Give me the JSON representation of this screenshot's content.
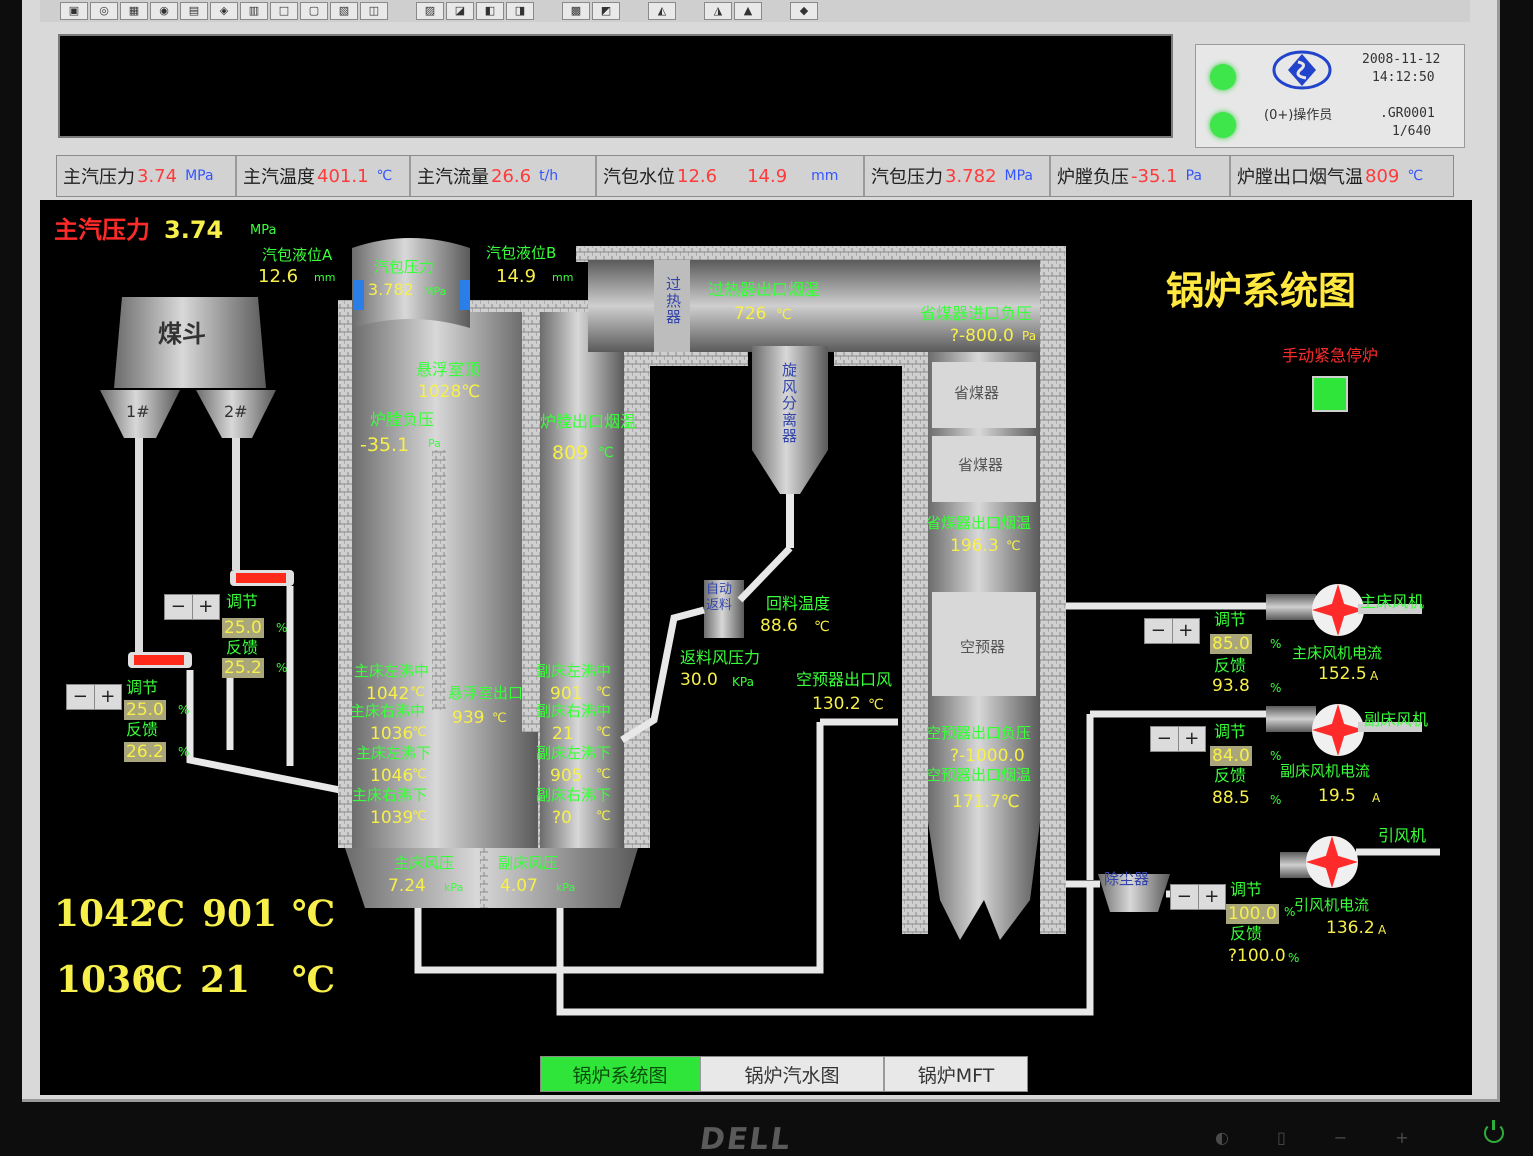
{
  "toolbar": {
    "buttons": [
      "▣",
      "◎",
      "▦",
      "◉",
      "▤",
      "◈",
      "▥",
      "□",
      "▢",
      "▧",
      "◫",
      "▨",
      "◪",
      "◧",
      "◨",
      "▩",
      "◩",
      "◭",
      "◮",
      "▲",
      "◆"
    ]
  },
  "status": {
    "datetime_line1": "2008-11-12",
    "datetime_line2": "14:12:50",
    "operator": "(0+)操作员",
    "code_line1": ".GR0001",
    "code_line2": "1/640"
  },
  "params": [
    {
      "label": "主汽压力",
      "value": "3.74",
      "unit": "MPa"
    },
    {
      "label": "主汽温度",
      "value": "401.1",
      "unit": "℃"
    },
    {
      "label": "主汽流量",
      "value": "26.6",
      "unit": "t/h"
    },
    {
      "label": "汽包水位",
      "value": "12.6",
      "value2": "14.9",
      "unit": "mm"
    },
    {
      "label": "汽包压力",
      "value": "3.782",
      "unit": "MPa"
    },
    {
      "label": "炉膛负压",
      "value": "-35.1",
      "unit": "Pa"
    },
    {
      "label": "炉膛出口烟气温",
      "value": "809",
      "unit": "℃"
    }
  ],
  "diagram": {
    "title": "锅炉系统图",
    "main_pressure_label": "主汽压力",
    "main_pressure_value": "3.74",
    "main_pressure_unit": "MPa",
    "drum_level_a_label": "汽包液位A",
    "drum_level_a_value": "12.6",
    "drum_level_a_unit": "mm",
    "drum_pressure_label": "汽包压力",
    "drum_pressure_value": "3.782",
    "drum_pressure_unit": "MPa",
    "drum_level_b_label": "汽包液位B",
    "drum_level_b_value": "14.9",
    "drum_level_b_unit": "mm",
    "coal_hopper": "煤斗",
    "hopper_1": "1#",
    "hopper_2": "2#",
    "superheater": "过热器",
    "superheater_outlet_label": "过热器出口烟温",
    "superheater_outlet_value": "726",
    "superheater_outlet_unit": "℃",
    "economizer_inlet_label": "省煤器进口负压",
    "economizer_inlet_value": "?-800.0",
    "economizer_inlet_unit": "Pa",
    "suspended_top_label": "悬浮室顶",
    "suspended_top_value": "1028℃",
    "furnace_neg_label": "炉膛负压",
    "furnace_neg_value": "-35.1",
    "furnace_neg_unit": "Pa",
    "furnace_outlet_label": "炉膛出口烟温",
    "furnace_outlet_value": "809",
    "furnace_outlet_unit": "℃",
    "cyclone": "旋风分离器",
    "economizer_1": "省煤器",
    "economizer_2": "省煤器",
    "economizer_outlet_label": "省煤器出口烟温",
    "economizer_outlet_value": "196.3",
    "economizer_outlet_unit": "℃",
    "return_feeder": "自动返料",
    "return_temp_label": "回料温度",
    "return_temp_value": "88.6",
    "return_temp_unit": "℃",
    "return_air_label": "返料风压力",
    "return_air_value": "30.0",
    "return_air_unit": "KPa",
    "air_preheater": "空预器",
    "preheater_air_label": "空预器出口风",
    "preheater_air_value": "130.2",
    "preheater_air_unit": "℃",
    "preheater_neg_label": "空预器出口负压",
    "preheater_neg_value": "?-1000.0",
    "preheater_smoke_label": "空预器出口烟温",
    "preheater_smoke_value": "171.7℃",
    "main_bed_lm_label": "主床左沸中",
    "main_bed_lm_value": "1042",
    "main_bed_rm_label": "主床右沸中",
    "main_bed_rm_value": "1036",
    "main_bed_ll_label": "主床左沸下",
    "main_bed_ll_value": "1046",
    "main_bed_rl_label": "主床右沸下",
    "main_bed_rl_value": "1039",
    "temp_unit": "℃",
    "suspended_out_label": "悬浮室出口",
    "suspended_out_value": "939",
    "aux_bed_lm_label": "副床左沸中",
    "aux_bed_lm_value": "901",
    "aux_bed_rm_label": "副床右沸中",
    "aux_bed_rm_value": "21",
    "aux_bed_ll_label": "副床左沸下",
    "aux_bed_ll_value": "905",
    "aux_bed_rl_label": "副床右沸下",
    "aux_bed_rl_value": "?0",
    "main_bed_air_label": "主床风压",
    "main_bed_air_value": "7.24",
    "main_bed_air_unit": "kPa",
    "aux_bed_air_label": "副床风压",
    "aux_bed_air_value": "4.07",
    "aux_bed_air_unit": "kPa",
    "dust_collector": "除尘器",
    "emergency_stop": "手动紧急停炉",
    "feeder2": {
      "adjust": "调节",
      "adjust_value": "25.0",
      "feedback": "反馈",
      "feedback_value": "25.2",
      "unit": "%"
    },
    "feeder1": {
      "adjust": "调节",
      "adjust_value": "25.0",
      "feedback": "反馈",
      "feedback_value": "26.2",
      "unit": "%"
    },
    "main_fan": {
      "name": "主床风机",
      "adjust": "调节",
      "adjust_value": "85.0",
      "feedback": "反馈",
      "feedback_value": "93.8",
      "unit": "%",
      "current_label": "主床风机电流",
      "current_value": "152.5",
      "current_unit": "A"
    },
    "aux_fan": {
      "name": "副床风机",
      "adjust": "调节",
      "adjust_value": "84.0",
      "feedback": "反馈",
      "feedback_value": "88.5",
      "unit": "%",
      "current_label": "副床风机电流",
      "current_value": "19.5",
      "current_unit": "A"
    },
    "id_fan": {
      "name": "引风机",
      "adjust": "调节",
      "adjust_value": "100.0",
      "feedback": "反馈",
      "feedback_value": "?100.0",
      "unit": "%",
      "current_label": "引风机电流",
      "current_value": "136.2",
      "current_unit": "A"
    },
    "big_t1": "1042",
    "big_t2": "901",
    "big_t3": "1036",
    "big_t4": "21",
    "big_unit": "℃",
    "minus": "−",
    "plus": "+"
  },
  "tabs": [
    {
      "label": "锅炉系统图",
      "active": true
    },
    {
      "label": "锅炉汽水图",
      "active": false
    },
    {
      "label": "锅炉MFT",
      "active": false
    }
  ],
  "bezel": {
    "brand": "DELL",
    "buttons": [
      "◐",
      "▯",
      "−",
      "+"
    ]
  }
}
